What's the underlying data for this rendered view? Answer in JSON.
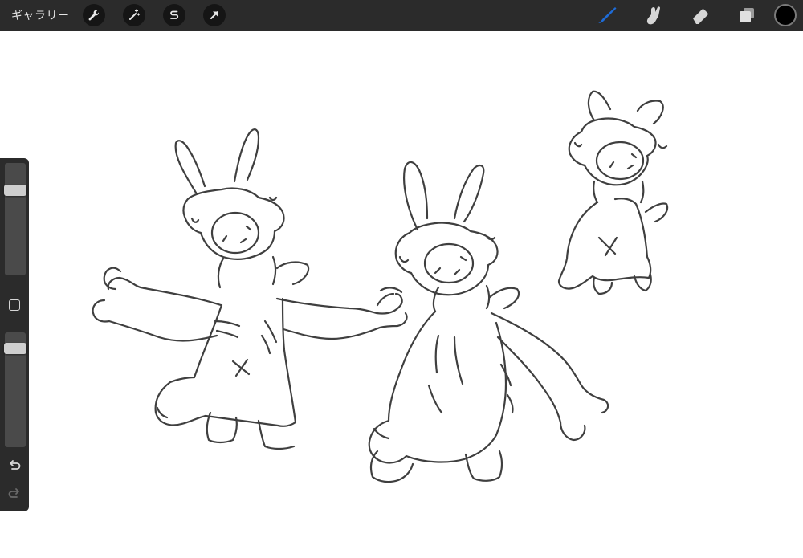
{
  "toolbar": {
    "gallery_label": "ギャラリー",
    "left_tools": [
      {
        "name": "wrench-icon"
      },
      {
        "name": "magic-wand-icon"
      },
      {
        "name": "selection-s-icon"
      },
      {
        "name": "transform-arrow-icon"
      }
    ],
    "right_tools": [
      {
        "name": "brush-icon",
        "active": true
      },
      {
        "name": "smudge-icon"
      },
      {
        "name": "eraser-icon"
      },
      {
        "name": "layers-icon"
      }
    ],
    "current_color": "#000000",
    "active_color": "#1e6bd6"
  },
  "sidebar": {
    "brush_size_level": 0.12,
    "opacity_level": 0.12,
    "buttons": [
      "modify-square-button",
      "undo-icon",
      "redo-icon"
    ]
  }
}
